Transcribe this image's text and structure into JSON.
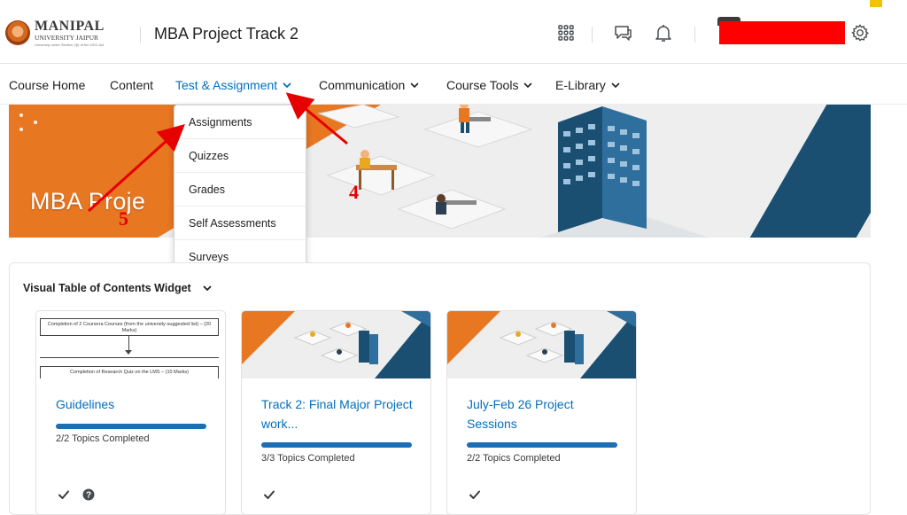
{
  "header": {
    "logo_main": "MANIPAL",
    "logo_sub": "UNIVERSITY JAIPUR",
    "logo_tag": "University under Section 2(f) of the UGC Act",
    "course_title": "MBA Project Track 2",
    "icons": [
      "apps-grid-icon",
      "message-icon",
      "bell-icon",
      "gear-icon"
    ]
  },
  "nav": {
    "items": [
      {
        "label": "Course Home"
      },
      {
        "label": "Content"
      },
      {
        "label": "Test & Assignment"
      },
      {
        "label": "Communication"
      },
      {
        "label": "Course Tools"
      },
      {
        "label": "E-Library"
      }
    ]
  },
  "banner": {
    "title": "MBA Proje",
    "colors": {
      "orange": "#e87722",
      "blue": "#1b4f72",
      "gray": "#eeeeee"
    }
  },
  "dropdown": {
    "items": [
      {
        "label": "Assignments"
      },
      {
        "label": "Quizzes"
      },
      {
        "label": "Grades"
      },
      {
        "label": "Self Assessments"
      },
      {
        "label": "Surveys"
      }
    ]
  },
  "annotations": {
    "step_4": "4",
    "step_5": "5",
    "color": "#e60000"
  },
  "widget": {
    "title": "Visual Table of Contents Widget",
    "cards": [
      {
        "title": "Guidelines",
        "progress": 1.0,
        "status": "2/2  Topics Completed",
        "flow_top": "Completion of 2 Coursera Courses (from the university-suggested list) – (20 Marks)",
        "flow_bottom": "Completion of Research Quiz on the LMS – (10 Marks)"
      },
      {
        "title": "Track 2: Final Major Project work...",
        "progress": 1.0,
        "status": "3/3  Topics Completed"
      },
      {
        "title": "July-Feb 26 Project Sessions",
        "progress": 1.0,
        "status": "2/2  Topics Completed"
      }
    ]
  },
  "colors": {
    "accent": "#006fbf",
    "progress": "#1c6fb5"
  }
}
